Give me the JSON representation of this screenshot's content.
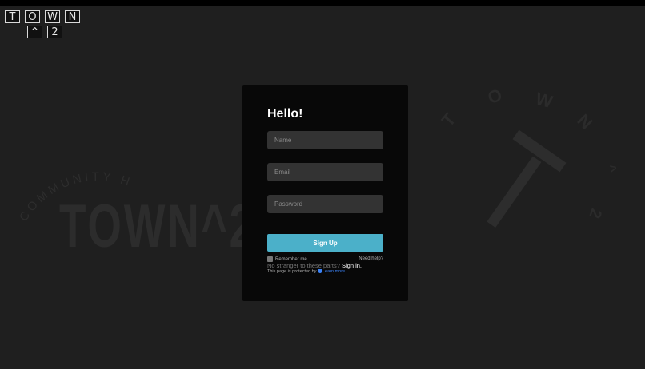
{
  "logo": {
    "row1": [
      "T",
      "O",
      "W",
      "N"
    ],
    "row2": [
      "^",
      "2"
    ]
  },
  "watermark_left": {
    "arc_text": "COMMUNITY HUB",
    "big_text": "TOWN^2"
  },
  "watermark_right": {
    "letters": [
      "T",
      "O",
      "W",
      "N",
      "^",
      "2"
    ]
  },
  "form": {
    "title": "Hello!",
    "name_placeholder": "Name",
    "email_placeholder": "Email",
    "password_placeholder": "Password",
    "signup_label": "Sign Up",
    "remember_label": "Remember me",
    "need_help": "Need help?",
    "stranger_text": "No stranger to these parts?",
    "signin_link": "Sign in.",
    "protected_text": "This page is protected by",
    "learn_more": "Learn more."
  },
  "colors": {
    "background": "#1f1f1f",
    "card": "#080808",
    "input": "#333333",
    "accent": "#4bb0c9",
    "link": "#3b82f6"
  }
}
